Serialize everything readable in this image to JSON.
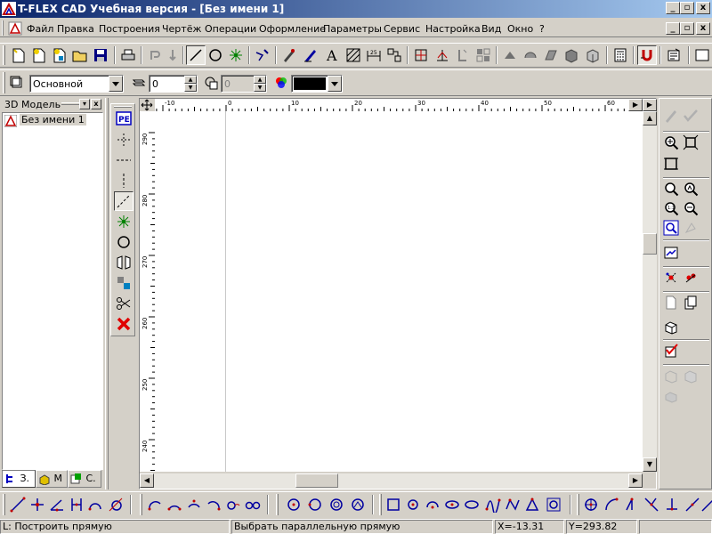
{
  "window": {
    "title": "T-FLEX CAD Учебная версия - [Без имени 1]",
    "controls": [
      "_",
      "▫",
      "x"
    ],
    "doc_controls": [
      "_",
      "▫",
      "x"
    ]
  },
  "menu": {
    "items": [
      "Файл",
      "Правка",
      "Построения",
      "Чертёж",
      "Операции",
      "Оформление",
      "Параметры",
      "Сервис",
      "Настройка",
      "Вид",
      "Окно",
      "?"
    ]
  },
  "props_toolbar": {
    "layer": "Основной",
    "level": "0",
    "priority": "0",
    "color_hex": "#000000"
  },
  "left_panel": {
    "title": "3D Модель",
    "tree_item": "Без имени 1",
    "tabs": [
      "З.",
      "М",
      "С."
    ]
  },
  "ruler": {
    "h_labels": [
      "-10",
      "0",
      "10",
      "20",
      "30",
      "40",
      "50",
      "60"
    ],
    "v_labels": [
      "290",
      "280",
      "270",
      "260",
      "250",
      "240"
    ]
  },
  "status": {
    "command": "L: Построить прямую",
    "prompt": "Выбрать параллельную прямую",
    "x": "X=-13.31",
    "y": "Y=293.82"
  },
  "colors": {
    "titlebar_start": "#0a246a",
    "titlebar_end": "#a6caf0",
    "face": "#d4d0c8",
    "canvas": "#ffffff",
    "accent_red": "#c00000",
    "accent_blue": "#0000c0"
  }
}
